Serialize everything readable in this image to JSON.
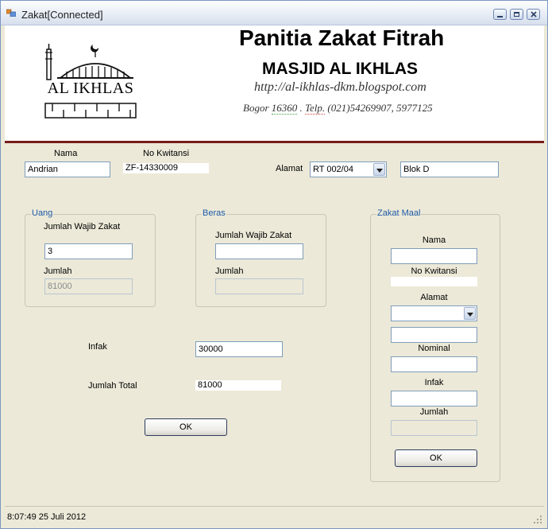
{
  "window": {
    "title": "Zakat[Connected]"
  },
  "header": {
    "logo_text": "AL IKHLAS",
    "title": "Panitia Zakat Fitrah",
    "subtitle": "MASJID AL IKHLAS",
    "url": "http://al-ikhlas-dkm.blogspot.com",
    "address_city": "Bogor",
    "address_zip": "16360",
    "address_sep": " . ",
    "address_telp": "Telp.",
    "address_phone": " (021)54269907, 5977125"
  },
  "top": {
    "nama_label": "Nama",
    "nama_value": "Andrian",
    "kwitansi_label": "No Kwitansi",
    "kwitansi_value": "ZF-14330009",
    "alamat_label": "Alamat",
    "alamat_value": "RT 002/04",
    "blok_value": "Blok D"
  },
  "uang": {
    "title": "Uang",
    "wajib_label": "Jumlah Wajib Zakat",
    "wajib_value": "3",
    "jumlah_label": "Jumlah",
    "jumlah_value": "81000"
  },
  "beras": {
    "title": "Beras",
    "wajib_label": "Jumlah Wajib Zakat",
    "wajib_value": "",
    "jumlah_label": "Jumlah",
    "jumlah_value": ""
  },
  "maal": {
    "title": "Zakat Maal",
    "nama_label": "Nama",
    "nama_value": "",
    "kwitansi_label": "No Kwitansi",
    "kwitansi_value": "",
    "alamat_label": "Alamat",
    "alamat_value": "",
    "alamat2_value": "",
    "nominal_label": "Nominal",
    "nominal_value": "",
    "infak_label": "Infak",
    "infak_value": "",
    "jumlah_label": "Jumlah",
    "jumlah_value": "",
    "ok_label": "OK"
  },
  "bottom": {
    "infak_label": "Infak",
    "infak_value": "30000",
    "total_label": "Jumlah Total",
    "total_value": "81000",
    "ok_label": "OK"
  },
  "status": {
    "text": "8:07:49  25 Juli 2012"
  },
  "colors": {
    "group_title": "#1e5aa8",
    "header_rule": "#7a1c1c"
  }
}
